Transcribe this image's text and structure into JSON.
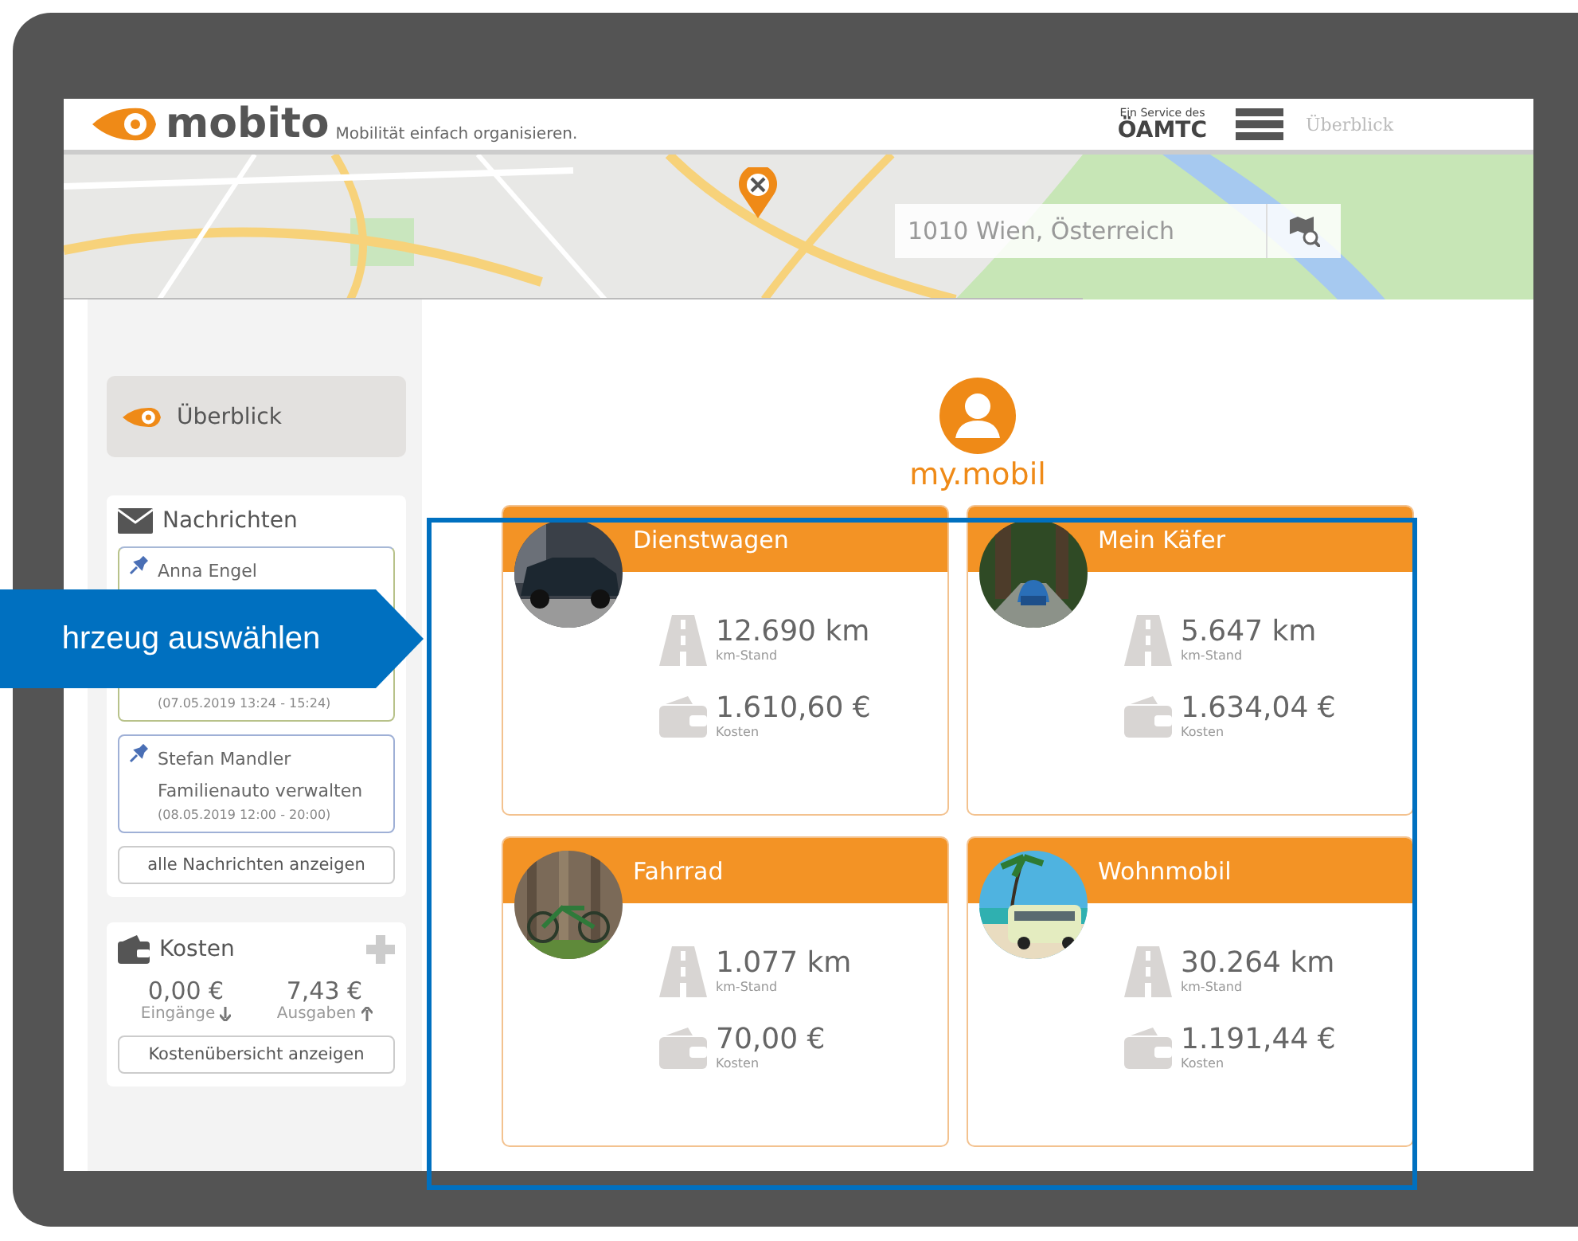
{
  "header": {
    "logo": "mobito",
    "tagline": "Mobilität einfach organisieren.",
    "service_label": "Ein Service des",
    "service_brand": "ÖAMTC",
    "nav_link": "Überblick"
  },
  "map": {
    "search": {
      "value": "1010 Wien, Österreich"
    }
  },
  "sidebar": {
    "overview": {
      "label": "Überblick",
      "selected": true
    },
    "messages": {
      "title": "Nachrichten",
      "items": [
        {
          "sender": "Anna Engel",
          "date": "(07.05.2019 13:24 - 15:24)"
        },
        {
          "sender": "Stefan Mandler",
          "subject": "Familienauto verwalten",
          "date": "(08.05.2019 12:00 - 20:00)"
        }
      ],
      "button": "alle Nachrichten anzeigen"
    },
    "costs": {
      "title": "Kosten",
      "income": "0,00 €",
      "income_label": "Eingänge",
      "expenses": "7,43 €",
      "expenses_label": "Ausgaben",
      "button": "Kostenübersicht anzeigen"
    }
  },
  "main": {
    "title": "my.mobil",
    "vehicles": [
      {
        "name": "Dienstwagen",
        "km": "12.690 km",
        "km_label": "km-Stand",
        "costs": "1.610,60 €",
        "costs_label": "Kosten"
      },
      {
        "name": "Mein Käfer",
        "km": "5.647 km",
        "km_label": "km-Stand",
        "costs": "1.634,04 €",
        "costs_label": "Kosten"
      },
      {
        "name": "Fahrrad",
        "km": "1.077 km",
        "km_label": "km-Stand",
        "costs": "70,00 €",
        "costs_label": "Kosten"
      },
      {
        "name": "Wohnmobil",
        "km": "30.264 km",
        "km_label": "km-Stand",
        "costs": "1.191,44 €",
        "costs_label": "Kosten"
      }
    ]
  },
  "callout": {
    "text": "hrzeug auswählen"
  }
}
